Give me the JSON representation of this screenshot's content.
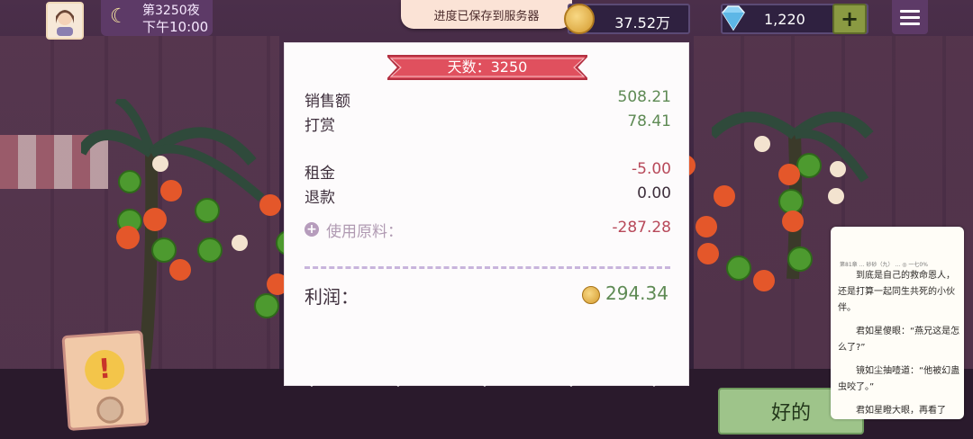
{
  "hud": {
    "day_label": "第3250夜",
    "time_label": "下午10:00",
    "toast": "进度已保存到服务器",
    "coins": "37.52万",
    "gems": "1,220",
    "plus_label": "+"
  },
  "receipt": {
    "banner": "天数：3250",
    "rows": [
      {
        "label": "销售额",
        "value": "508.21"
      },
      {
        "label": "打赏",
        "value": "78.41"
      },
      {
        "label": "租金",
        "value": "-5.00"
      },
      {
        "label": "退款",
        "value": "0.00"
      }
    ],
    "materials_label": "使用原料：",
    "materials_value": "-287.28",
    "profit_label": "利润：",
    "profit_value": "294.34"
  },
  "ok_label": "好的",
  "alert_mark": "!",
  "reader": {
    "header": "第81章   …   砂砂（九）   …   ◎ 一七0%",
    "paragraphs": [
      "到底是自己的救命恩人，",
      "还是打算一起同生共死的小伙",
      "伴。",
      "君如星傻眼：“燕兄这是怎",
      "么了?”",
      "镜如尘抽噎道：“他被幻蛊",
      "虫咬了。”",
      "君如星瞪大眼，再看了"
    ]
  },
  "colors": {
    "profit_green": "#5e8a54",
    "negative_red": "#b8495a",
    "banner_red": "#e0505e",
    "ok_green": "#9ec48a"
  }
}
